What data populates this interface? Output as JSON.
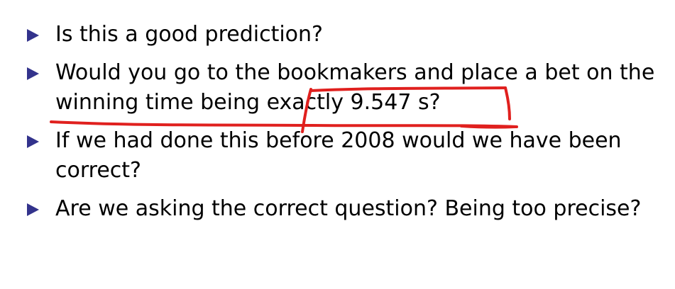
{
  "slide": {
    "bullets": [
      {
        "text": "Is this a good prediction?"
      },
      {
        "text": "Would you go to the bookmakers and place a bet on the winning time being exactly 9.547 s?"
      },
      {
        "text": "If we had done this before 2008 would we have been correct?"
      },
      {
        "text": "Are we asking the correct question? Being too precise?"
      }
    ],
    "marker_color": "#33338c",
    "annotation_color": "#e0201e"
  }
}
